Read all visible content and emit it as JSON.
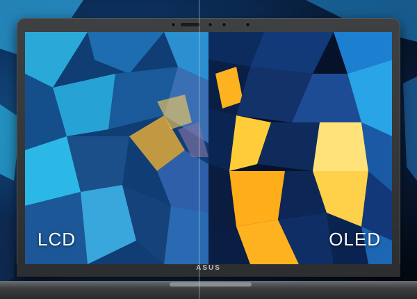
{
  "comparison": {
    "left_label": "LCD",
    "right_label": "OLED"
  },
  "brand": {
    "logo_text": "ASUS"
  },
  "colors": {
    "lcd_tint": "#1a8fc8",
    "oled_highlight": "#ffb21f",
    "bezel": "#2c2e30"
  }
}
